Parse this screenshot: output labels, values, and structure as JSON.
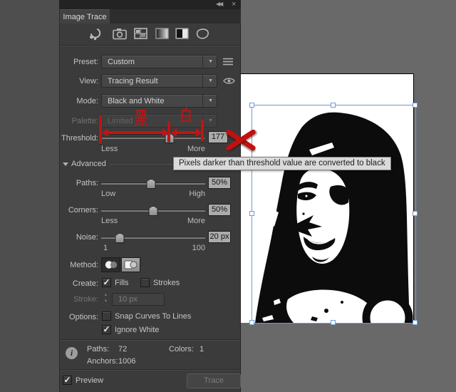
{
  "window": {
    "collapse_icon": "◀◀",
    "close_icon": "×"
  },
  "glyphs": {
    "check": "✓",
    "dropdown_arrow": "▼",
    "advanced_arrow": "▼",
    "spin_up": "▲",
    "spin_down": "▼",
    "info": "i"
  },
  "colors": {
    "accent_red": "#c01414",
    "selection_blue": "#6f9ad7",
    "panel_bg": "#3b3b3b",
    "artboard_white": "#ffffff"
  },
  "panel": {
    "tab_title": "Image Trace",
    "toolbar_icons": [
      "auto-color",
      "high-color",
      "low-color",
      "grayscale",
      "black-and-white",
      "outline"
    ],
    "rows": {
      "preset": {
        "label": "Preset:",
        "value": "Custom"
      },
      "view": {
        "label": "View:",
        "value": "Tracing Result"
      },
      "mode": {
        "label": "Mode:",
        "value": "Black and White"
      },
      "palette": {
        "label": "Palette:",
        "value": "Limited",
        "disabled": true
      },
      "threshold": {
        "label": "Threshold:",
        "value": "177",
        "percent": 66,
        "min_label": "Less",
        "max_label": "More"
      },
      "advanced": {
        "label": "Advanced"
      },
      "paths": {
        "label": "Paths:",
        "value": "50%",
        "percent": 48,
        "min_label": "Low",
        "max_label": "High"
      },
      "corners": {
        "label": "Corners:",
        "value": "50%",
        "percent": 50,
        "min_label": "Less",
        "max_label": "More"
      },
      "noise": {
        "label": "Noise:",
        "value": "20 px",
        "percent": 18,
        "min_label": "1",
        "max_label": "100"
      },
      "method": {
        "label": "Method:",
        "selected": "abutting"
      },
      "create": {
        "label": "Create:",
        "fills_label": "Fills",
        "fills_checked": true,
        "strokes_label": "Strokes",
        "strokes_checked": false
      },
      "stroke": {
        "label": "Stroke:",
        "value": "10 px",
        "disabled": true
      },
      "options": {
        "label": "Options:",
        "snap_label": "Snap Curves To Lines",
        "snap_checked": false,
        "ignore_label": "Ignore White",
        "ignore_checked": true
      }
    },
    "stats": {
      "paths_label": "Paths:",
      "paths_value": "72",
      "colors_label": "Colors:",
      "colors_value": "1",
      "anchors_label": "Anchors:",
      "anchors_value": "1006"
    },
    "footer": {
      "preview_label": "Preview",
      "preview_checked": true,
      "trace_label": "Trace"
    }
  },
  "annotations": {
    "black_char": "黑",
    "white_char": "白",
    "tooltip": "Pixels darker than threshold value are converted to black"
  }
}
